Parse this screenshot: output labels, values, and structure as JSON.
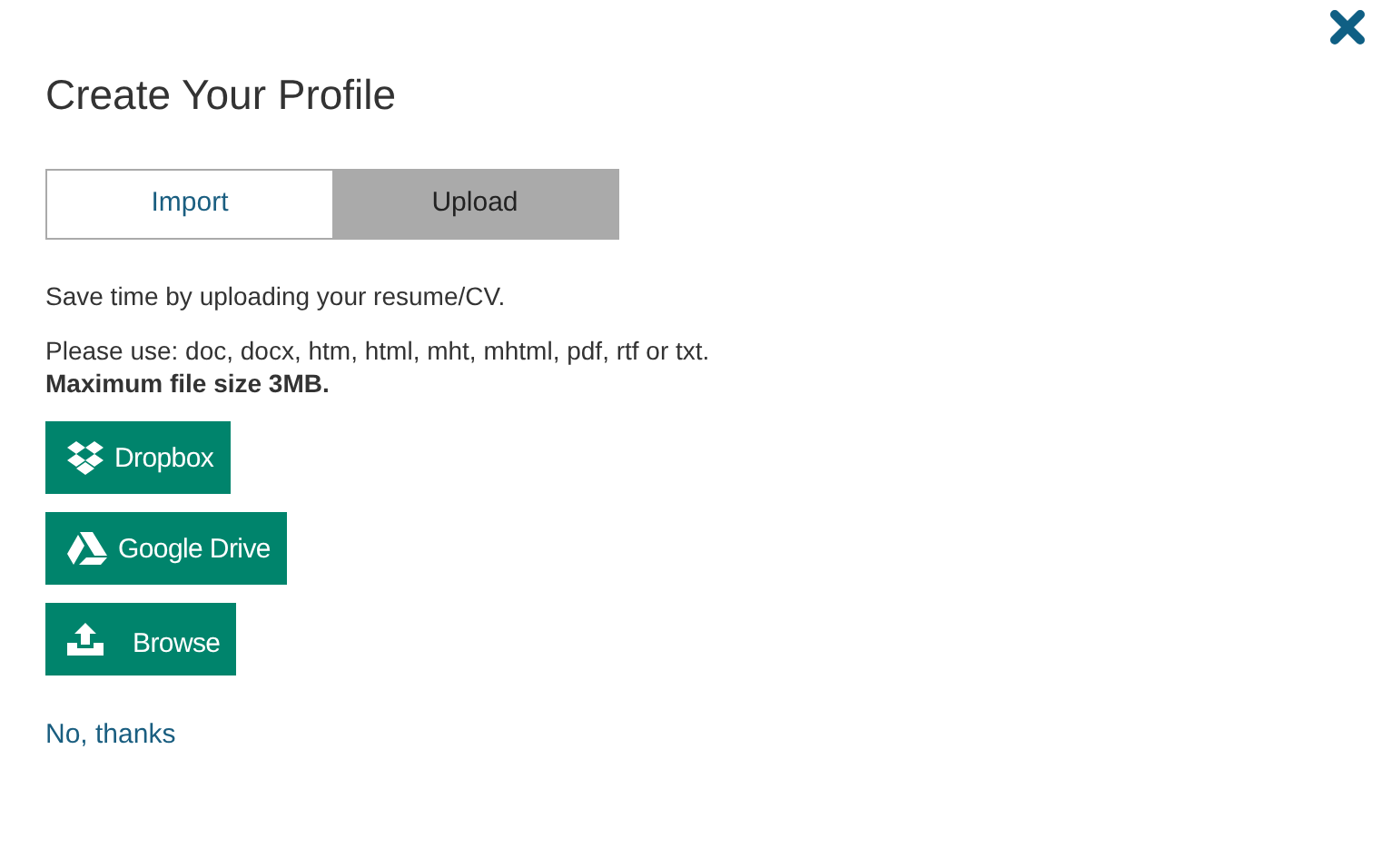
{
  "title": "Create Your Profile",
  "tabs": [
    {
      "label": "Import",
      "selected": false
    },
    {
      "label": "Upload",
      "selected": true
    }
  ],
  "intro": "Save time by uploading your resume/CV.",
  "formats": "Please use: doc, docx, htm, html, mht, mhtml, pdf, rtf or txt.",
  "max_size": "Maximum file size 3MB.",
  "buttons": [
    {
      "kind": "dropbox",
      "label": "Dropbox"
    },
    {
      "kind": "drive",
      "label": "Google Drive"
    },
    {
      "kind": "upload",
      "label": "Browse"
    }
  ],
  "skip_link": "No, thanks"
}
